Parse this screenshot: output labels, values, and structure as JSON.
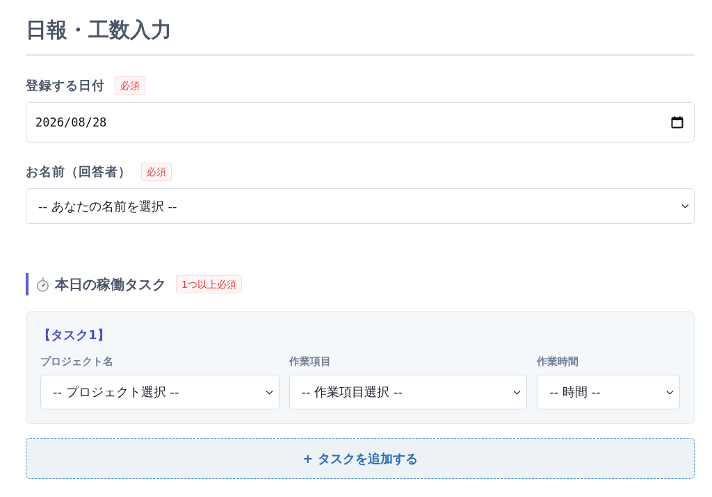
{
  "title": "日報・工数入力",
  "fields": [
    {
      "kind": "date",
      "label": "登録する日付",
      "badge": "必須",
      "value": "2026/08/28"
    },
    {
      "kind": "select",
      "label": "お名前（回答者）",
      "badge": "必須",
      "value": "-- あなたの名前を選択 --"
    }
  ],
  "task_section": {
    "heading": "本日の稼働タスク",
    "badge": "1つ以上必須",
    "tasks": [
      {
        "title": "【タスク1】",
        "fields": [
          {
            "label": "プロジェクト名",
            "value": "-- プロジェクト選択 --"
          },
          {
            "label": "作業項目",
            "value": "-- 作業項目選択 --"
          },
          {
            "label": "作業時間",
            "value": "-- 時間 --"
          }
        ]
      }
    ],
    "add_button": "+ タスクを追加する"
  }
}
